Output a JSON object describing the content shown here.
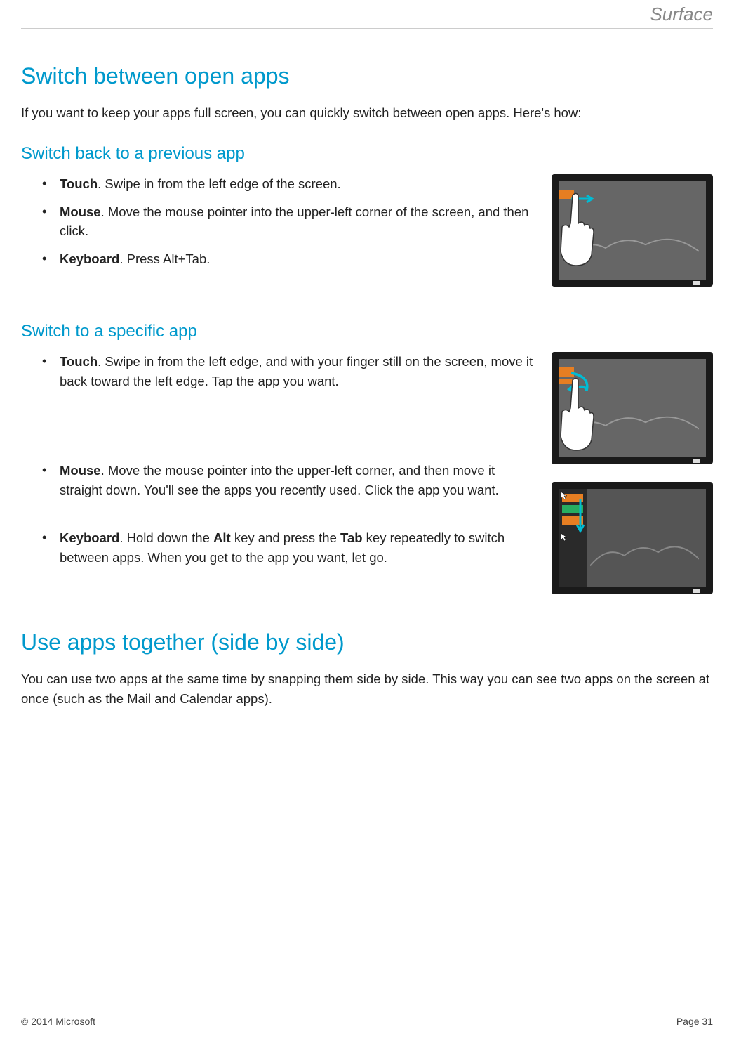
{
  "header": {
    "brand": "Surface"
  },
  "main": {
    "heading1": "Switch between open apps",
    "intro": "If you want to keep your apps full screen, you can quickly switch between open apps. Here's how:",
    "section1": {
      "heading": "Switch back to a previous app",
      "items": [
        {
          "bold": "Touch",
          "text": ". Swipe in from the left edge of the screen."
        },
        {
          "bold": "Mouse",
          "text": ". Move the mouse pointer into the upper-left corner of the screen, and then click."
        },
        {
          "bold": "Keyboard",
          "text": ". Press Alt+Tab."
        }
      ]
    },
    "section2": {
      "heading": "Switch to a specific app",
      "touch": {
        "bold": "Touch",
        "text": ". Swipe in from the left edge, and with your finger still on the screen, move it back toward the left edge. Tap the app you want."
      },
      "mouse": {
        "bold": "Mouse",
        "text": ". Move the mouse pointer into the upper-left corner, and then move it straight down. You'll see the apps you recently used. Click the app you want."
      },
      "keyboard": {
        "bold": "Keyboard",
        "pre": ". Hold down the ",
        "bold2": "Alt",
        "mid": " key and press the ",
        "bold3": "Tab",
        "post": " key repeatedly to switch between apps. When you get to the app you want, let go."
      }
    },
    "heading2": "Use apps together (side by side)",
    "body2": "You can use two apps at the same time by snapping them side by side. This way you can see two apps on the screen at once (such as the Mail and Calendar apps)."
  },
  "footer": {
    "copyright": "© 2014 Microsoft",
    "page": "Page 31"
  }
}
